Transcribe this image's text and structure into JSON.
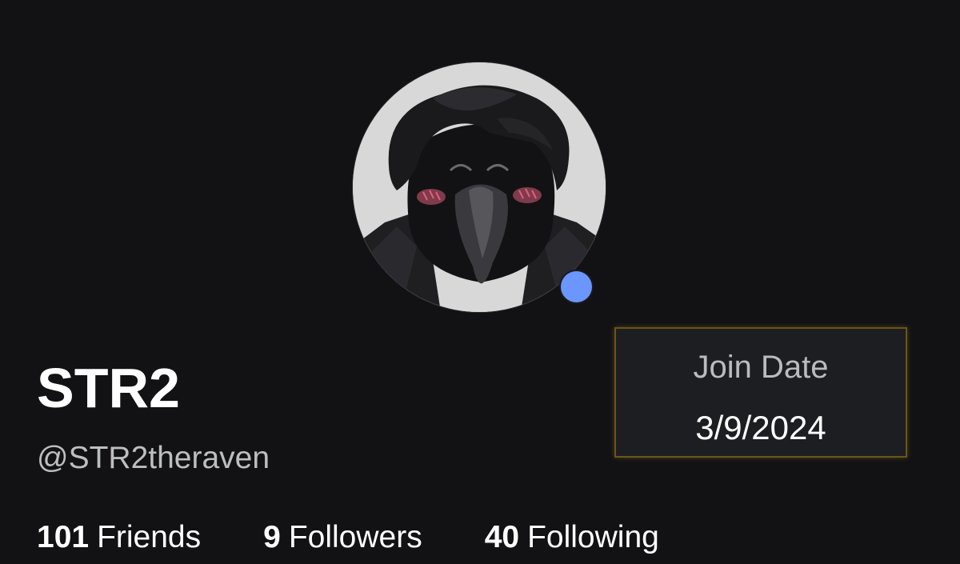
{
  "profile": {
    "display_name": "STR2",
    "username": "@STR2theraven",
    "avatar_icon": "raven-avatar-icon",
    "presence_color": "#6b96ff"
  },
  "stats": {
    "friends": {
      "count": "101",
      "label": "Friends"
    },
    "followers": {
      "count": "9",
      "label": "Followers"
    },
    "following": {
      "count": "40",
      "label": "Following"
    }
  },
  "join_card": {
    "label": "Join Date",
    "value": "3/9/2024",
    "border_color": "#6b5418"
  },
  "colors": {
    "background": "#121215",
    "card_background": "#1c1e21",
    "secondary_text": "#bdbec1"
  }
}
